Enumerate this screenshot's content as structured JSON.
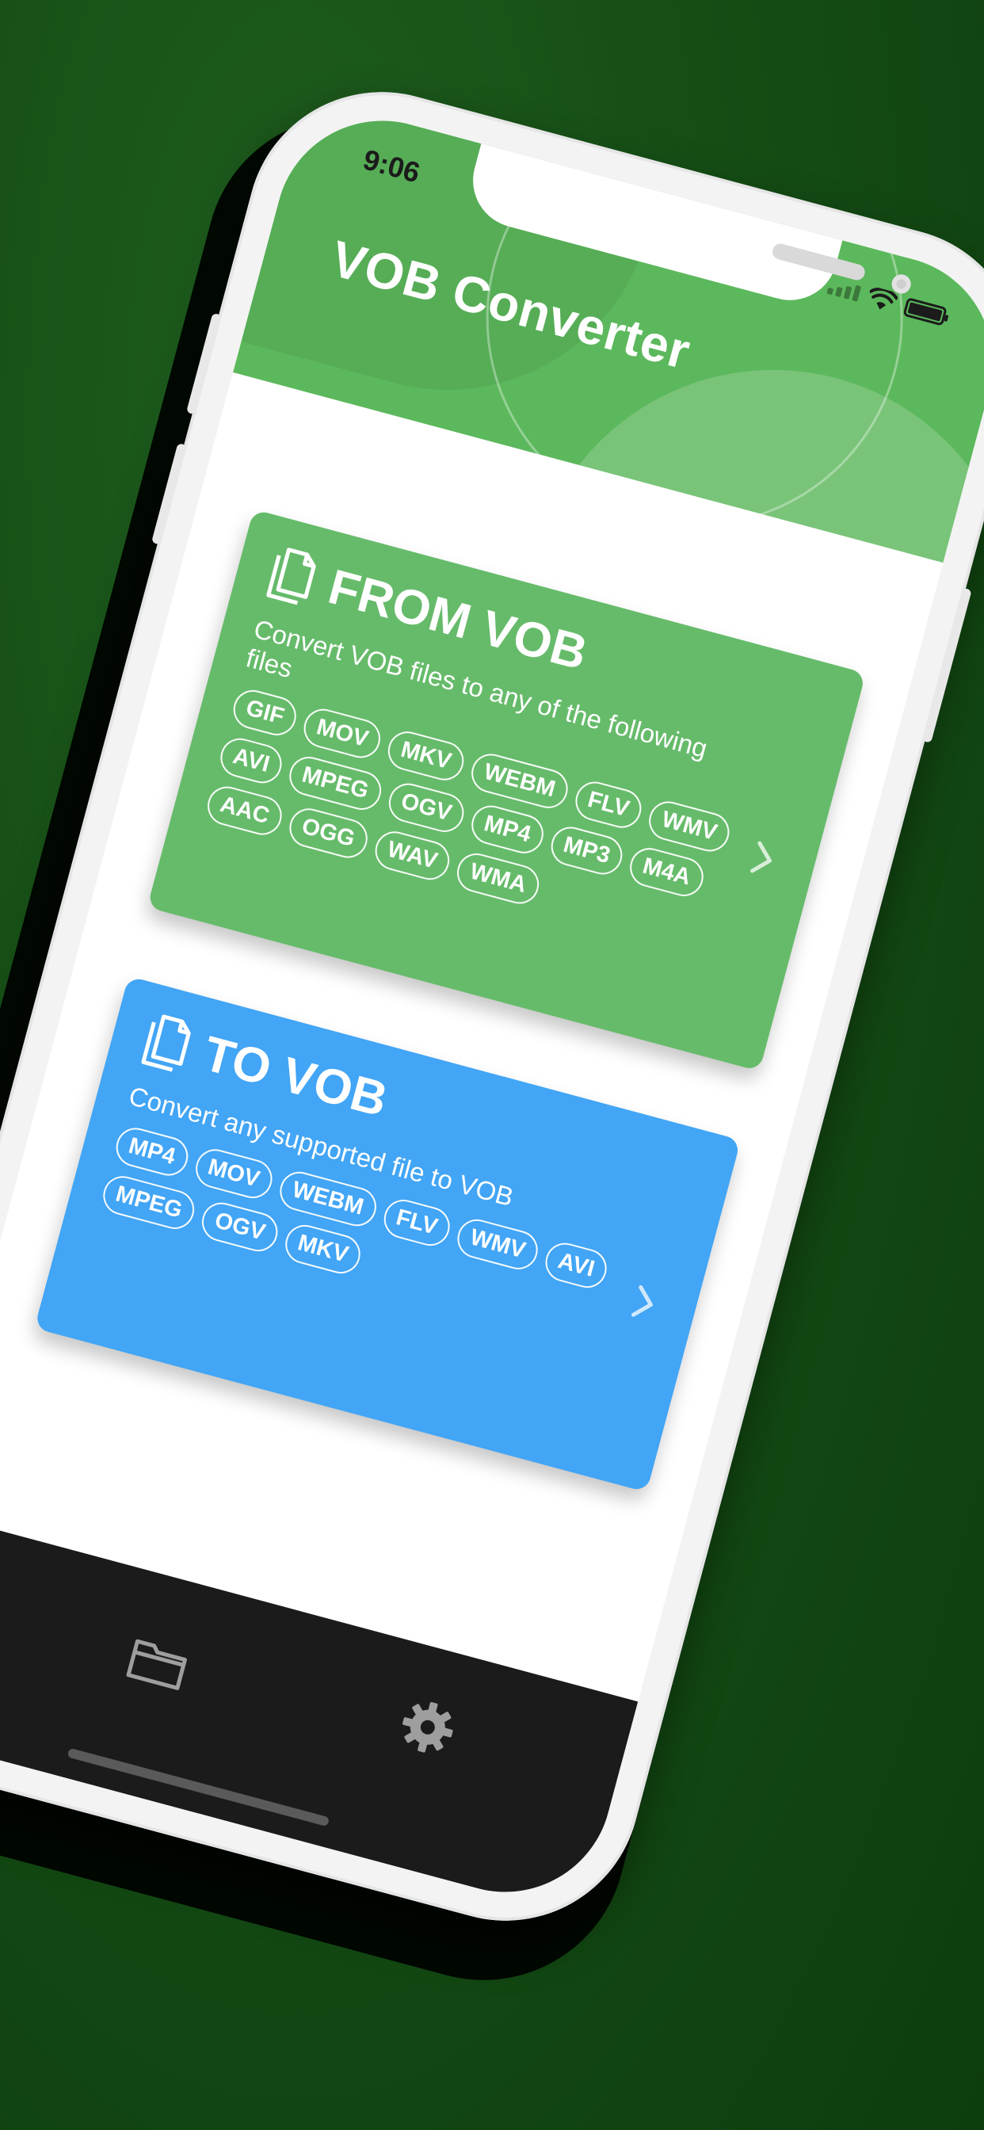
{
  "status_bar": {
    "time": "9:06"
  },
  "header": {
    "title": "VOB Converter"
  },
  "cards": {
    "from": {
      "title": "FROM VOB",
      "description": "Convert VOB files to any of the following files",
      "formats": [
        "GIF",
        "MOV",
        "MKV",
        "WEBM",
        "FLV",
        "WMV",
        "AVI",
        "MPEG",
        "OGV",
        "MP4",
        "MP3",
        "M4A",
        "AAC",
        "OGG",
        "WAV",
        "WMA"
      ],
      "color": "#66bb6a"
    },
    "to": {
      "title": "TO VOB",
      "description": "Convert any supported file to VOB",
      "formats": [
        "MP4",
        "MOV",
        "WEBM",
        "FLV",
        "WMV",
        "AVI",
        "MPEG",
        "OGV",
        "MKV"
      ],
      "color": "#42a5f5"
    }
  },
  "tab_bar": {
    "icons": [
      "folder-icon",
      "gear-icon"
    ]
  },
  "colors": {
    "background": "#154d15",
    "header": "#5cb85c"
  }
}
